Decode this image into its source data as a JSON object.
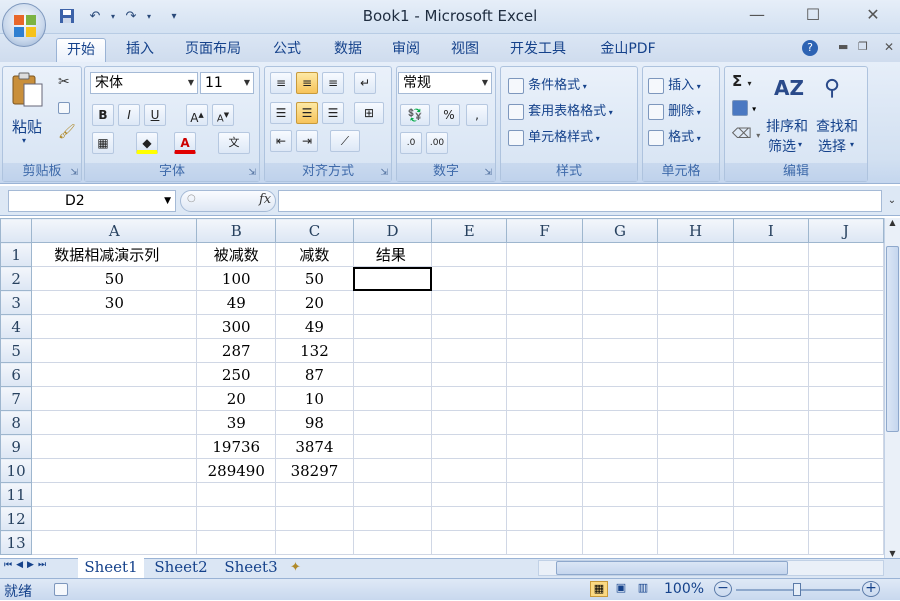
{
  "window": {
    "title": "Book1 - Microsoft Excel"
  },
  "qat": {
    "save_icon": "save-icon",
    "undo_icon": "undo-icon",
    "redo_icon": "redo-icon",
    "customize_icon": "customize-icon"
  },
  "window_controls": {
    "minimize": "—",
    "maximize": "☐",
    "close": "✕"
  },
  "tabs": [
    "开始",
    "插入",
    "页面布局",
    "公式",
    "数据",
    "审阅",
    "视图",
    "开发工具",
    "金山PDF"
  ],
  "ribbon": {
    "clipboard": {
      "paste": "粘贴",
      "label": "剪贴板"
    },
    "font": {
      "name": "宋体",
      "size": "11",
      "label": "字体"
    },
    "alignment": {
      "label": "对齐方式"
    },
    "number": {
      "format": "常规",
      "percent": "%",
      "comma": ",",
      "inc_dec": ".0 .00",
      "label": "数字"
    },
    "styles": {
      "conditional": "条件格式",
      "table": "套用表格格式",
      "cell": "单元格样式",
      "label": "样式"
    },
    "cells": {
      "insert": "插入",
      "delete": "删除",
      "format": "格式",
      "label": "单元格"
    },
    "editing": {
      "sort_filter_1": "排序和",
      "sort_filter_2": "筛选",
      "find_select_1": "查找和",
      "find_select_2": "选择",
      "label": "编辑"
    }
  },
  "formula_bar": {
    "name_box": "D2",
    "fx": "fx",
    "value": ""
  },
  "columns": [
    "A",
    "B",
    "C",
    "D",
    "E",
    "F",
    "G",
    "H",
    "I",
    "J"
  ],
  "rows": [
    {
      "n": "1",
      "A": "数据相减演示列",
      "B": "被减数",
      "C": "减数",
      "D": "结果"
    },
    {
      "n": "2",
      "A": "50",
      "B": "100",
      "C": "50",
      "D": ""
    },
    {
      "n": "3",
      "A": "30",
      "B": "49",
      "C": "20",
      "D": ""
    },
    {
      "n": "4",
      "A": "",
      "B": "300",
      "C": "49",
      "D": ""
    },
    {
      "n": "5",
      "A": "",
      "B": "287",
      "C": "132",
      "D": ""
    },
    {
      "n": "6",
      "A": "",
      "B": "250",
      "C": "87",
      "D": ""
    },
    {
      "n": "7",
      "A": "",
      "B": "20",
      "C": "10",
      "D": ""
    },
    {
      "n": "8",
      "A": "",
      "B": "39",
      "C": "98",
      "D": ""
    },
    {
      "n": "9",
      "A": "",
      "B": "19736",
      "C": "3874",
      "D": ""
    },
    {
      "n": "10",
      "A": "",
      "B": "289490",
      "C": "38297",
      "D": ""
    },
    {
      "n": "11",
      "A": "",
      "B": "",
      "C": "",
      "D": ""
    },
    {
      "n": "12",
      "A": "",
      "B": "",
      "C": "",
      "D": ""
    },
    {
      "n": "13",
      "A": "",
      "B": "",
      "C": "",
      "D": ""
    }
  ],
  "sheets": [
    "Sheet1",
    "Sheet2",
    "Sheet3"
  ],
  "status": {
    "text": "就绪",
    "zoom": "100%"
  }
}
